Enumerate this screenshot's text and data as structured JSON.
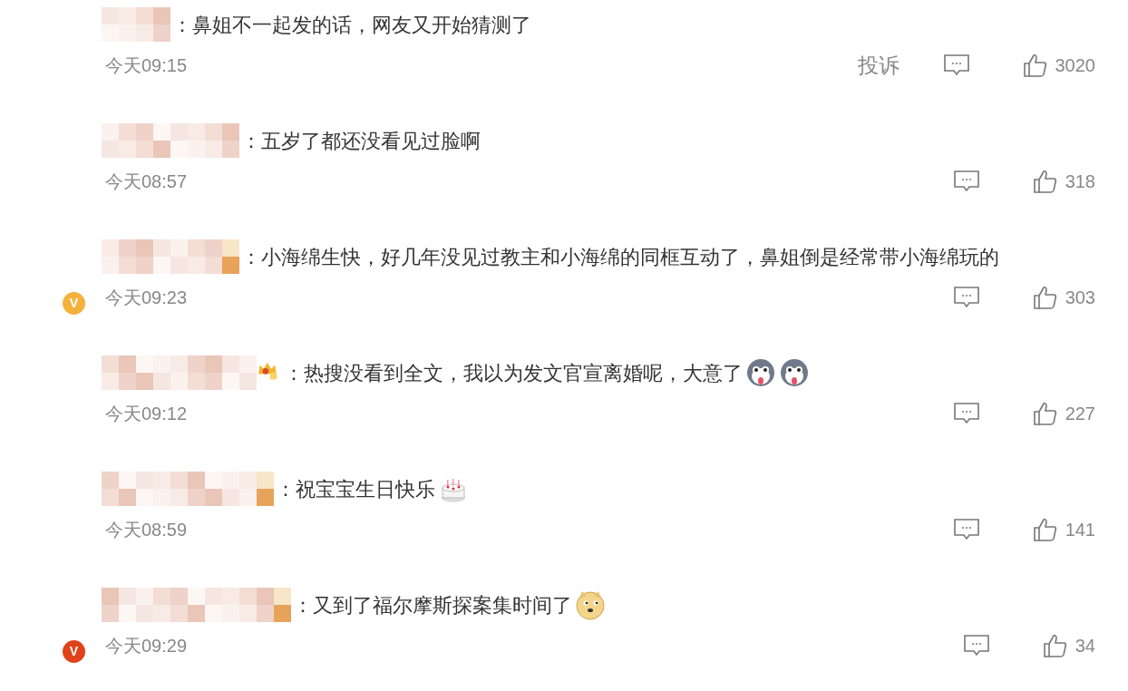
{
  "comments": [
    {
      "text": "鼻姐不一起发的话，网友又开始猜测了",
      "time": "今天09:15",
      "report": "投诉",
      "likes": "3020"
    },
    {
      "text": "五岁了都还没看见过脸啊",
      "time": "今天08:57",
      "likes": "318"
    },
    {
      "text": "小海绵生快，好几年没见过教主和小海绵的同框互动了，鼻姐倒是经常带小海绵玩的",
      "time": "今天09:23",
      "likes": "303",
      "verified": {
        "letter": "V",
        "color": "#f3b23c"
      }
    },
    {
      "text": "热搜没看到全文，我以为发文官宣离婚呢，大意了",
      "time": "今天09:12",
      "likes": "227",
      "name_badge": {
        "kind": "crown"
      },
      "emojis": [
        {
          "kind": "husky"
        },
        {
          "kind": "husky"
        }
      ]
    },
    {
      "text": "祝宝宝生日快乐",
      "time": "今天08:59",
      "likes": "141",
      "emojis": [
        {
          "kind": "cake"
        }
      ]
    },
    {
      "text": "又到了福尔摩斯探案集时间了",
      "time": "今天09:29",
      "likes": "34",
      "verified": {
        "letter": "V",
        "color": "#e0421b"
      },
      "emojis": [
        {
          "kind": "doge"
        }
      ]
    }
  ],
  "separator": "："
}
